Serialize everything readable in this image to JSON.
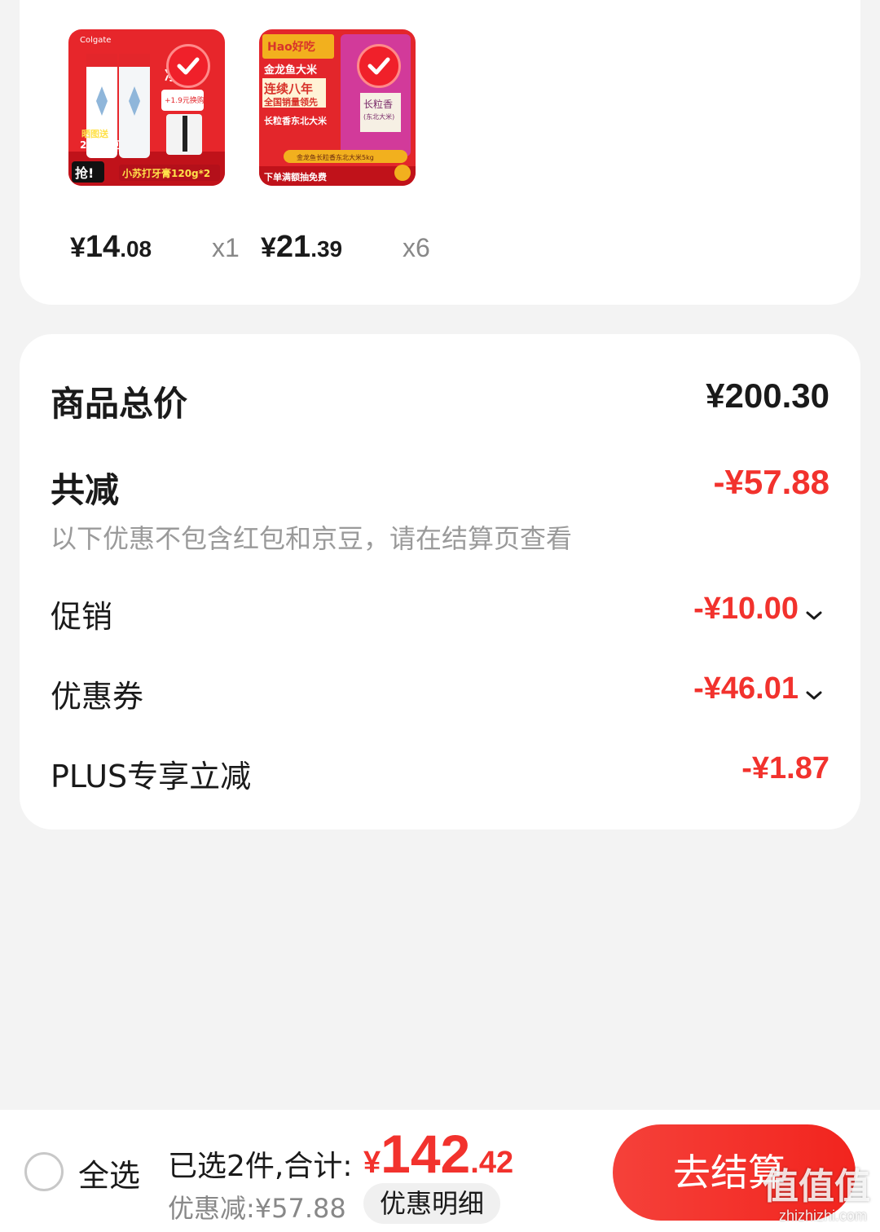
{
  "products": [
    {
      "image_text": [
        "Colgate",
        "净白",
        "+1.9元换购",
        "晒图送",
        "200京豆",
        "抢!",
        "小苏打牙膏120g*2"
      ],
      "price_currency": "¥",
      "price_int": "14",
      "price_dec": ".08",
      "quantity": "x1"
    },
    {
      "image_text": [
        "Hao好吃",
        "金龙鱼大米",
        "连续八年",
        "全国销量领先",
        "长粒香东北大米",
        "长粒香",
        "(东北大米)",
        "金龙鱼长粒香东北大米5kg",
        "下单满额抽免费"
      ],
      "price_currency": "¥",
      "price_int": "21",
      "price_dec": ".39",
      "quantity": "x6"
    }
  ],
  "summary": {
    "total_label": "商品总价",
    "total_value": "¥200.30",
    "discount_label": "共减",
    "discount_value": "-¥57.88",
    "note": "以下优惠不包含红包和京豆，请在结算页查看",
    "promo_label": "促销",
    "promo_value": "-¥10.00",
    "coupon_label": "优惠券",
    "coupon_value": "-¥46.01",
    "plus_label": "PLUS专享立减",
    "plus_value": "-¥1.87"
  },
  "bottom": {
    "select_all": "全选",
    "selected_text": "已选2件,合计:",
    "total_currency": "¥",
    "total_int": "142",
    "total_dec": ".42",
    "saved_text": "优惠减:¥57.88",
    "detail_button": "优惠明细",
    "checkout_button": "去结算"
  },
  "watermark": {
    "text": "值值值",
    "sub": "zhizhizhi.com"
  },
  "colors": {
    "accent_red": "#f2322d",
    "background": "#f3f3f3",
    "card": "#ffffff"
  },
  "icons": [
    "check-icon",
    "chevron-down-icon",
    "radio-icon"
  ]
}
